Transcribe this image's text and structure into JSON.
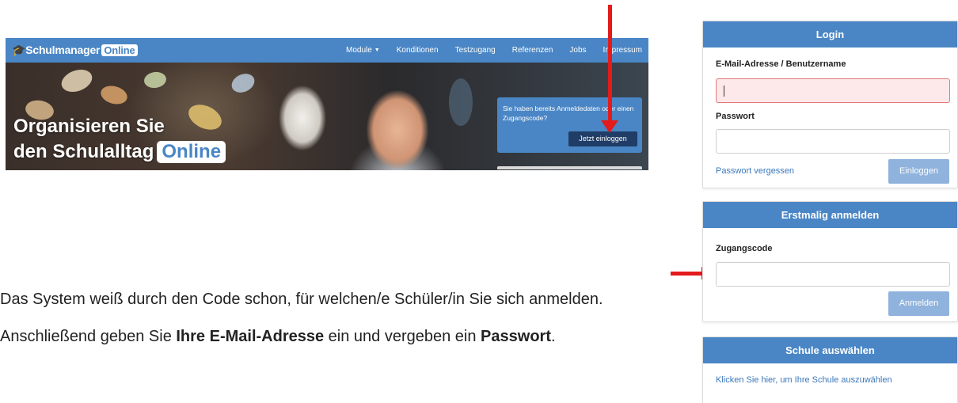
{
  "site": {
    "brand": {
      "name": "Schulmanager",
      "badge": "Online"
    },
    "nav": [
      {
        "label": "Module",
        "has_caret": true
      },
      {
        "label": "Konditionen"
      },
      {
        "label": "Testzugang"
      },
      {
        "label": "Referenzen"
      },
      {
        "label": "Jobs"
      },
      {
        "label": "Impressum"
      }
    ],
    "hero": {
      "headline_line1": "Organisieren Sie",
      "headline_line2": "den Schulalltag",
      "headline_badge": "Online"
    },
    "login_teaser": {
      "text": "Sie haben bereits Anmeldedaten oder einen Zugangscode?",
      "button_label": "Jetzt einloggen"
    }
  },
  "instructions": {
    "paragraph1": "Das System weiß durch den Code schon, für welchen/e Schüler/in Sie sich anmelden.",
    "paragraph2_prefix": "Anschließend geben Sie ",
    "paragraph2_bold1": "Ihre E-Mail-Adresse",
    "paragraph2_middle": " ein und vergeben ein ",
    "paragraph2_bold2": "Passwort",
    "paragraph2_suffix": "."
  },
  "login_card": {
    "title": "Login",
    "email_label": "E-Mail-Adresse / Benutzername",
    "email_value": "",
    "password_label": "Passwort",
    "password_value": "",
    "forgot_link": "Passwort vergessen",
    "submit_label": "Einloggen"
  },
  "first_login_card": {
    "title": "Erstmalig anmelden",
    "code_label": "Zugangscode",
    "code_value": "",
    "submit_label": "Anmelden"
  },
  "school_card": {
    "title": "Schule auswählen",
    "link": "Klicken Sie hier, um Ihre Schule auszuwählen"
  },
  "colors": {
    "brand_blue": "#4a86c5",
    "button_disabled": "#8fb3dc",
    "dark_button": "#1f3d66",
    "annotation_red": "#e31b1b",
    "error_field_bg": "#fde9e9"
  }
}
